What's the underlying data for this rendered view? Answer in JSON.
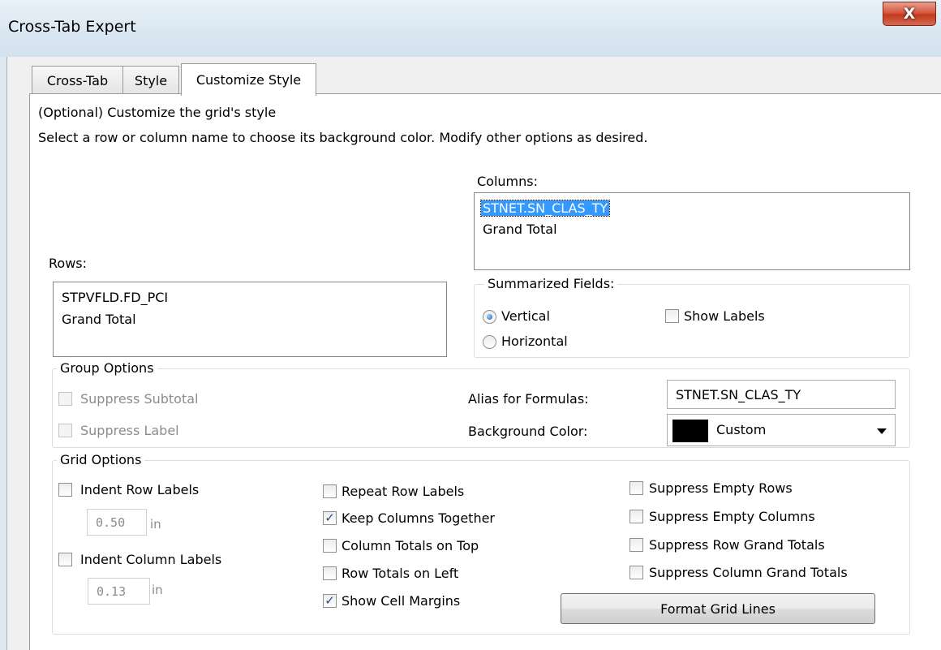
{
  "window": {
    "title": "Cross-Tab Expert",
    "close_glyph": "X"
  },
  "tabs": [
    {
      "label": "Cross-Tab"
    },
    {
      "label": "Style"
    },
    {
      "label": "Customize Style"
    }
  ],
  "intro": {
    "line1": "(Optional) Customize the grid's style",
    "line2": "Select a row or column name to choose its background color.  Modify other options as desired."
  },
  "columns": {
    "label": "Columns:",
    "items": [
      "STNET.SN_CLAS_TY",
      "Grand Total"
    ],
    "selected": "STNET.SN_CLAS_TY"
  },
  "rows": {
    "label": "Rows:",
    "items": [
      "STPVFLD.FD_PCI",
      "Grand Total"
    ]
  },
  "summarized": {
    "title": "Summarized Fields:",
    "vertical": "Vertical",
    "horizontal": "Horizontal",
    "selected": "Vertical",
    "show_labels": "Show Labels",
    "show_labels_checked": false
  },
  "group_options": {
    "title": "Group Options",
    "suppress_subtotal": "Suppress Subtotal",
    "suppress_label": "Suppress Label",
    "alias_label": "Alias for Formulas:",
    "alias_value": "STNET.SN_CLAS_TY",
    "bg_color_label": "Background Color:",
    "bg_color_value": "Custom",
    "bg_color_swatch": "#000000"
  },
  "grid_options": {
    "title": "Grid  Options",
    "indent_row_labels": "Indent Row Labels",
    "indent_row_value": "0.50",
    "indent_row_unit": "in",
    "indent_column_labels": "Indent Column Labels",
    "indent_column_value": "0.13",
    "indent_column_unit": "in",
    "repeat_row_labels": "Repeat Row Labels",
    "keep_columns_together": "Keep Columns Together",
    "column_totals_on_top": "Column Totals on Top",
    "row_totals_on_left": "Row Totals on Left",
    "show_cell_margins": "Show Cell Margins",
    "suppress_empty_rows": "Suppress Empty Rows",
    "suppress_empty_columns": "Suppress Empty Columns",
    "suppress_row_grand_totals": "Suppress Row Grand Totals",
    "suppress_column_grand_totals": "Suppress Column Grand Totals",
    "checked_states": {
      "indent_row_labels": false,
      "indent_column_labels": false,
      "repeat_row_labels": false,
      "keep_columns_together": true,
      "column_totals_on_top": false,
      "row_totals_on_left": false,
      "show_cell_margins": true,
      "suppress_empty_rows": false,
      "suppress_empty_columns": false,
      "suppress_row_grand_totals": false,
      "suppress_column_grand_totals": false
    },
    "format_grid_lines": "Format Grid Lines"
  },
  "colors": {
    "selection": "#3399ff",
    "close_button": "#c7432a",
    "group_border": "#d5dfe5"
  }
}
